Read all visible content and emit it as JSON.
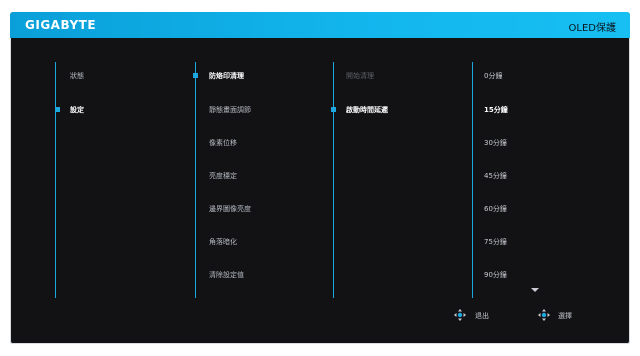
{
  "header": {
    "brand": "GIGABYTE",
    "mode": "OLED保護"
  },
  "level1": {
    "items": [
      {
        "label": "狀態",
        "state": "normal"
      },
      {
        "label": "設定",
        "state": "active"
      }
    ]
  },
  "level2": {
    "items": [
      {
        "label": "防烙印清理",
        "state": "active"
      },
      {
        "label": "靜態畫面調節",
        "state": "normal"
      },
      {
        "label": "像素位移",
        "state": "normal"
      },
      {
        "label": "亮度穩定",
        "state": "normal"
      },
      {
        "label": "邊界圖像亮度",
        "state": "normal"
      },
      {
        "label": "角落暗化",
        "state": "normal"
      },
      {
        "label": "清除設定值",
        "state": "normal"
      }
    ]
  },
  "level3": {
    "items": [
      {
        "label": "開始清理",
        "state": "dim"
      },
      {
        "label": "啟動時間延遲",
        "state": "active"
      }
    ]
  },
  "level4": {
    "options": [
      {
        "label": "0分鐘",
        "state": "normal"
      },
      {
        "label": "15分鐘",
        "state": "active"
      },
      {
        "label": "30分鐘",
        "state": "normal"
      },
      {
        "label": "45分鐘",
        "state": "normal"
      },
      {
        "label": "60分鐘",
        "state": "normal"
      },
      {
        "label": "75分鐘",
        "state": "normal"
      },
      {
        "label": "90分鐘",
        "state": "normal"
      }
    ],
    "more": "down-arrow"
  },
  "footer": {
    "exit_label": "退出",
    "select_label": "選擇",
    "exit_icon": "joystick-icon",
    "select_icon": "joystick-icon"
  }
}
